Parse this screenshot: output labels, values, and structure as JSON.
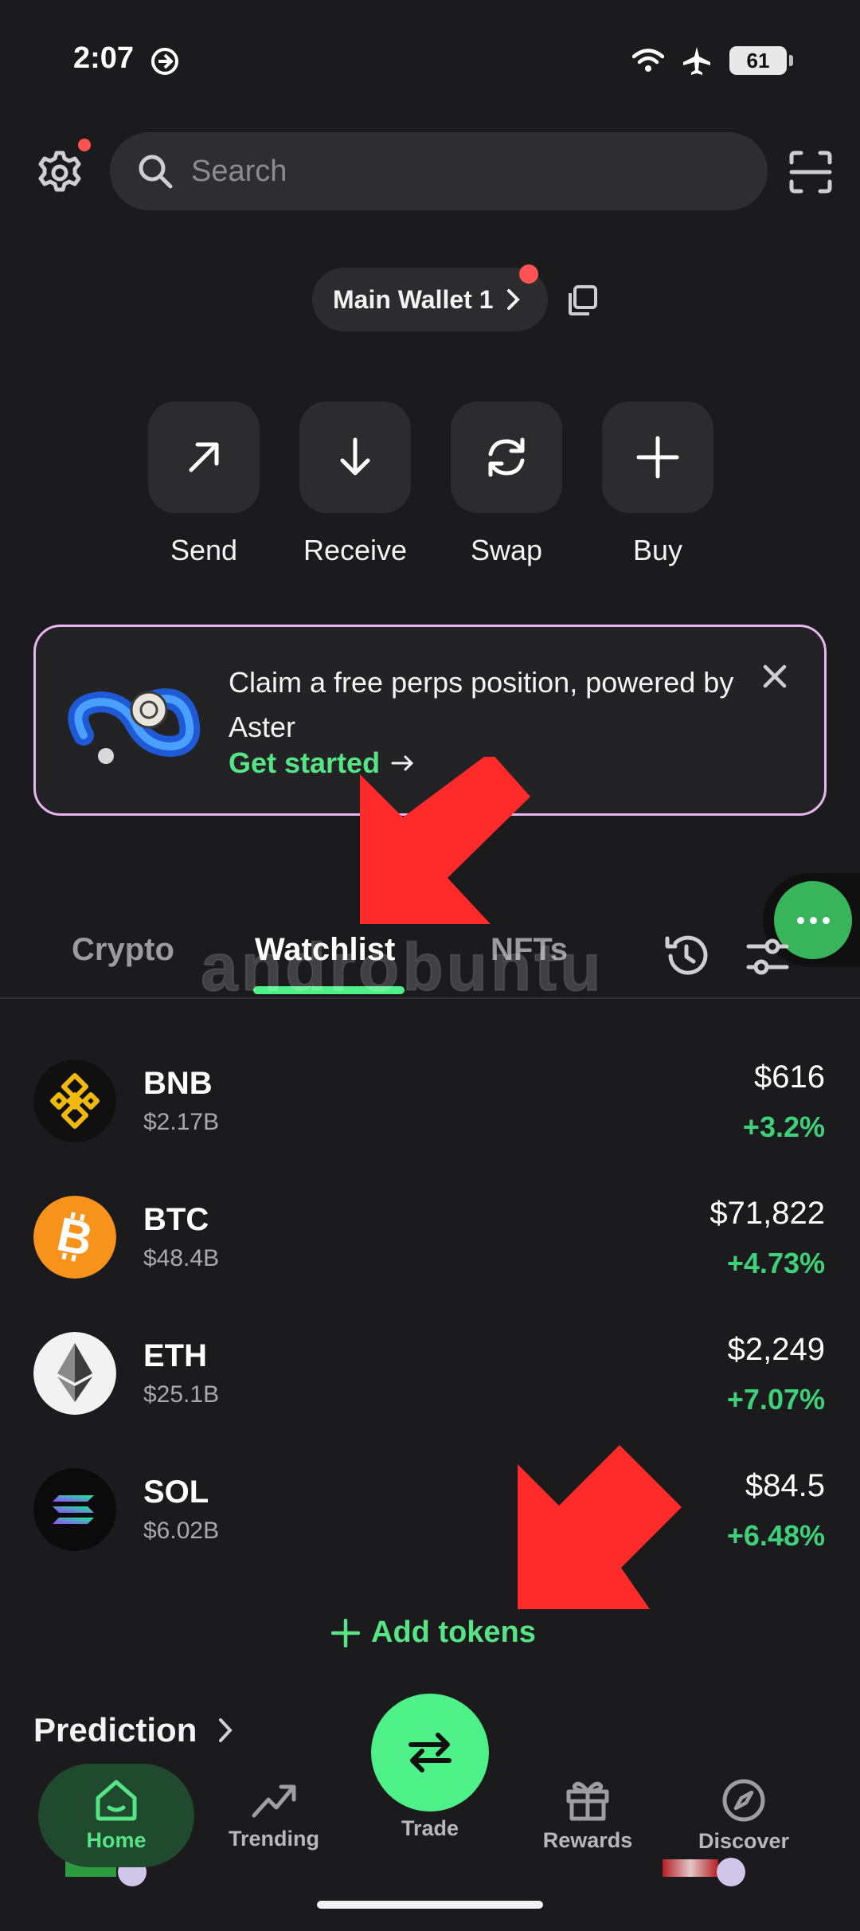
{
  "status_bar": {
    "time": "2:07",
    "battery": "61"
  },
  "header": {
    "search_placeholder": "Search"
  },
  "wallet": {
    "name": "Main Wallet 1"
  },
  "actions": [
    {
      "label": "Send",
      "icon": "arrow-up-right-icon"
    },
    {
      "label": "Receive",
      "icon": "arrow-down-icon"
    },
    {
      "label": "Swap",
      "icon": "refresh-icon"
    },
    {
      "label": "Buy",
      "icon": "plus-icon"
    }
  ],
  "promo": {
    "text": "Claim a free perps position, powered by Aster",
    "cta": "Get started"
  },
  "tabs": {
    "crypto": "Crypto",
    "watchlist": "Watchlist",
    "nfts": "NFTs",
    "active": "Watchlist"
  },
  "watermark": "androbuntu",
  "tokens": [
    {
      "symbol": "BNB",
      "market_cap": "$2.17B",
      "price": "$616",
      "change": "+3.2%"
    },
    {
      "symbol": "BTC",
      "market_cap": "$48.4B",
      "price": "$71,822",
      "change": "+4.73%"
    },
    {
      "symbol": "ETH",
      "market_cap": "$25.1B",
      "price": "$2,249",
      "change": "+7.07%"
    },
    {
      "symbol": "SOL",
      "market_cap": "$6.02B",
      "price": "$84.5",
      "change": "+6.48%"
    }
  ],
  "add_tokens": "Add tokens",
  "prediction": {
    "title": "Prediction"
  },
  "bottom_nav": {
    "home": "Home",
    "trending": "Trending",
    "trade": "Trade",
    "rewards": "Rewards",
    "discover": "Discover",
    "active": "Home"
  },
  "colors": {
    "background": "#1b1b1d",
    "accent_green": "#4df187",
    "positive_change": "#3fd07a",
    "annotation_arrow": "#ff2a2a",
    "promo_border": "#e7b7ef"
  }
}
